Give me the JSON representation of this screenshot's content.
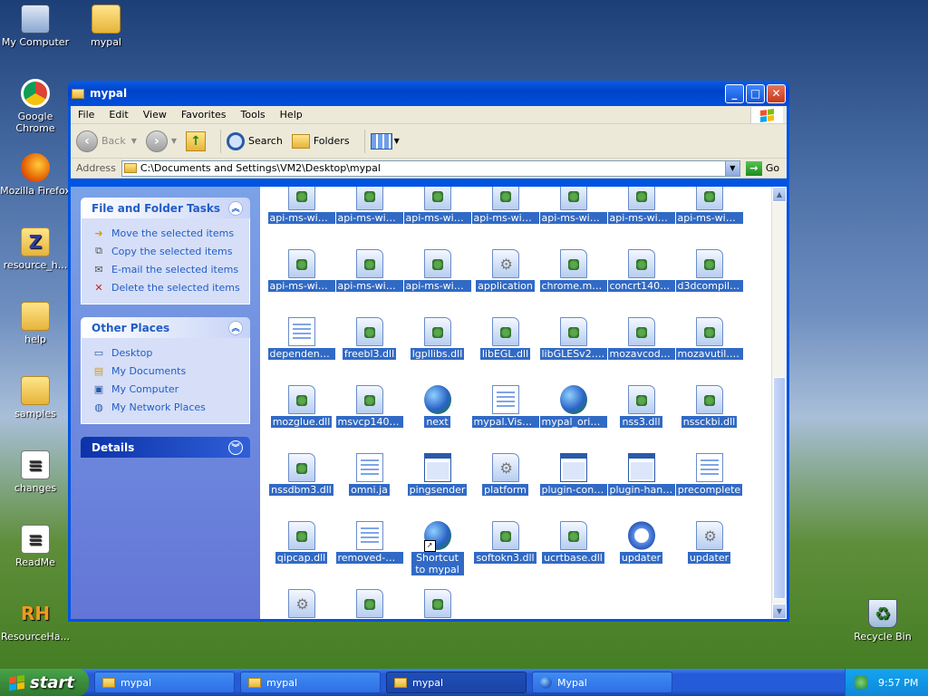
{
  "desktop": {
    "icons": [
      {
        "label": "My Computer"
      },
      {
        "label": "mypal"
      },
      {
        "label": "Google Chrome"
      },
      {
        "label": "Mozilla Firefox"
      },
      {
        "label": "resource_h..."
      },
      {
        "label": "help"
      },
      {
        "label": "samples"
      },
      {
        "label": "changes"
      },
      {
        "label": "ReadMe"
      },
      {
        "label": "ResourceHa..."
      },
      {
        "label": "Recycle Bin"
      }
    ],
    "rh_text": "RH",
    "zip_text": "Z"
  },
  "window": {
    "title": "mypal",
    "menu": [
      "File",
      "Edit",
      "View",
      "Favorites",
      "Tools",
      "Help"
    ],
    "toolbar": {
      "back": "Back",
      "search": "Search",
      "folders": "Folders"
    },
    "address": {
      "label": "Address",
      "value": "C:\\Documents and Settings\\VM2\\Desktop\\mypal",
      "go": "Go"
    }
  },
  "taskpane": {
    "file_tasks": {
      "title": "File and Folder Tasks",
      "items": [
        "Move the selected items",
        "Copy the selected items",
        "E-mail the selected items",
        "Delete the selected items"
      ]
    },
    "other_places": {
      "title": "Other Places",
      "items": [
        "Desktop",
        "My Documents",
        "My Computer",
        "My Network Places"
      ]
    },
    "details": {
      "title": "Details"
    }
  },
  "files": [
    {
      "label": "api-ms-win-...",
      "type": "dll"
    },
    {
      "label": "api-ms-win-...",
      "type": "dll"
    },
    {
      "label": "api-ms-win-...",
      "type": "dll"
    },
    {
      "label": "api-ms-win-...",
      "type": "dll"
    },
    {
      "label": "api-ms-win-...",
      "type": "dll"
    },
    {
      "label": "api-ms-win-...",
      "type": "dll"
    },
    {
      "label": "api-ms-win-...",
      "type": "dll"
    },
    {
      "label": "api-ms-win-...",
      "type": "dll"
    },
    {
      "label": "api-ms-win-...",
      "type": "dll"
    },
    {
      "label": "api-ms-win-...",
      "type": "dll"
    },
    {
      "label": "application",
      "type": "gear"
    },
    {
      "label": "chrome.man...",
      "type": "dll"
    },
    {
      "label": "concrt140.dll",
      "type": "dll"
    },
    {
      "label": "d3dcompiler...",
      "type": "dll"
    },
    {
      "label": "dependentli...",
      "type": "file"
    },
    {
      "label": "freebl3.dll",
      "type": "dll"
    },
    {
      "label": "lgpllibs.dll",
      "type": "dll"
    },
    {
      "label": "libEGL.dll",
      "type": "dll"
    },
    {
      "label": "libGLESv2.dll",
      "type": "dll"
    },
    {
      "label": "mozavcodec...",
      "type": "dll"
    },
    {
      "label": "mozavutil.dll",
      "type": "dll"
    },
    {
      "label": "mozglue.dll",
      "type": "dll"
    },
    {
      "label": "msvcp140.dll",
      "type": "dll"
    },
    {
      "label": "next",
      "type": "globe"
    },
    {
      "label": "mypal.Visu...",
      "type": "file"
    },
    {
      "label": "mypal_original",
      "type": "globe"
    },
    {
      "label": "nss3.dll",
      "type": "dll"
    },
    {
      "label": "nssckbi.dll",
      "type": "dll"
    },
    {
      "label": "nssdbm3.dll",
      "type": "dll"
    },
    {
      "label": "omni.ja",
      "type": "file"
    },
    {
      "label": "pingsender",
      "type": "app"
    },
    {
      "label": "platform",
      "type": "gear"
    },
    {
      "label": "plugin-cont...",
      "type": "app"
    },
    {
      "label": "plugin-hang-ui",
      "type": "app"
    },
    {
      "label": "precomplete",
      "type": "file"
    },
    {
      "label": "qipcap.dll",
      "type": "dll"
    },
    {
      "label": "removed-files",
      "type": "file"
    },
    {
      "label": "Shortcut to mypal",
      "type": "globe-shortcut"
    },
    {
      "label": "softokn3.dll",
      "type": "dll"
    },
    {
      "label": "ucrtbase.dll",
      "type": "dll"
    },
    {
      "label": "updater",
      "type": "refresh"
    },
    {
      "label": "updater",
      "type": "gear"
    },
    {
      "label": "",
      "type": "gear"
    },
    {
      "label": "",
      "type": "dll"
    },
    {
      "label": "",
      "type": "dll"
    }
  ],
  "taskbar": {
    "start": "start",
    "buttons": [
      {
        "label": "mypal",
        "icon": "folder",
        "active": false
      },
      {
        "label": "mypal",
        "icon": "folder",
        "active": false
      },
      {
        "label": "mypal",
        "icon": "folder",
        "active": true
      },
      {
        "label": "Mypal",
        "icon": "globe",
        "active": false
      }
    ],
    "clock": "9:57 PM"
  }
}
